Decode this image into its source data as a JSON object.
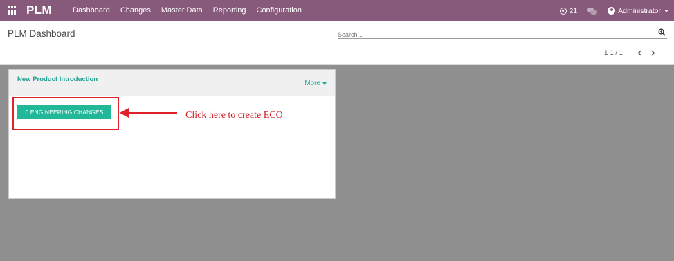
{
  "navbar": {
    "brand": "PLM",
    "menu": [
      "Dashboard",
      "Changes",
      "Master Data",
      "Reporting",
      "Configuration"
    ],
    "activity_count": "21",
    "user_name": "Administrator",
    "bg_color": "#875a7b"
  },
  "control_panel": {
    "title": "PLM Dashboard",
    "search_placeholder": "Search...",
    "pager": "1-1 / 1"
  },
  "card": {
    "title": "New Product Introduction",
    "more_label": "More",
    "eco_button_label": "0 ENGINEERING CHANGES",
    "accent_color": "#21b799"
  },
  "annotation": {
    "callout_text": "Click here to create ECO",
    "color": "#e0202a"
  }
}
